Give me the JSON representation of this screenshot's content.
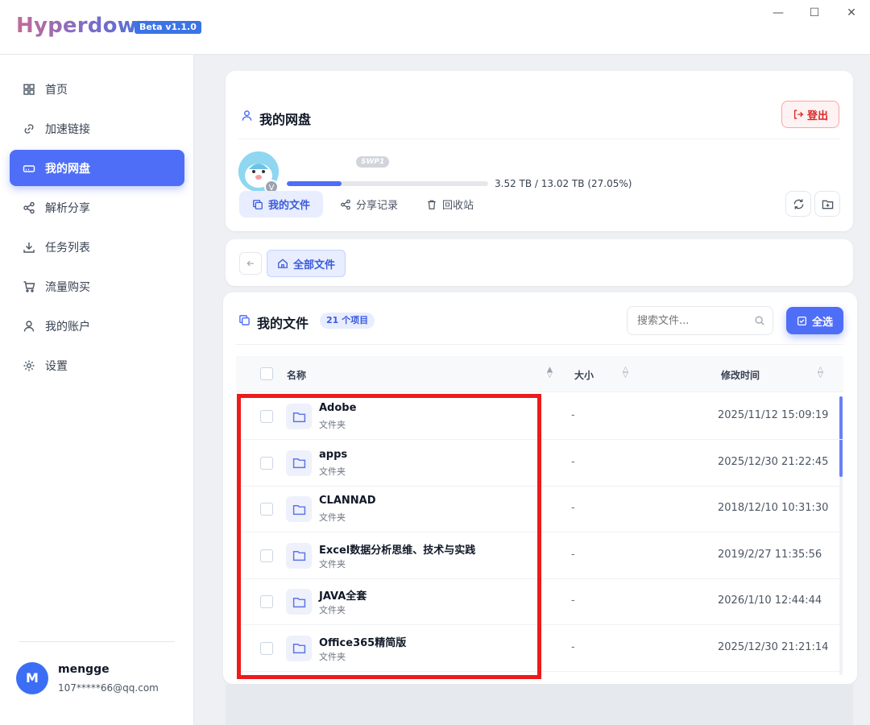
{
  "app": {
    "title": "Hyperdown",
    "version": "Beta v1.1.0",
    "window_controls": {
      "minimize": "—",
      "maximize": "☐",
      "close": "✕"
    }
  },
  "sidebar": {
    "items": [
      {
        "label": "首页",
        "icon": "grid-icon"
      },
      {
        "label": "加速链接",
        "icon": "link-icon"
      },
      {
        "label": "我的网盘",
        "icon": "drive-icon",
        "active": true
      },
      {
        "label": "解析分享",
        "icon": "share-icon"
      },
      {
        "label": "任务列表",
        "icon": "download-icon"
      },
      {
        "label": "流量购买",
        "icon": "cart-icon"
      },
      {
        "label": "我的账户",
        "icon": "user-icon"
      },
      {
        "label": "设置",
        "icon": "gear-icon"
      }
    ],
    "user": {
      "initial": "M",
      "name": "mengge",
      "email": "107*****66@qq.com"
    }
  },
  "account_card": {
    "title": "我的网盘",
    "logout_label": "登出",
    "tier_badge": "SWP1",
    "avatar_badge": "V",
    "quota_text": "3.52 TB / 13.02 TB (27.05%)",
    "quota_fraction": 0.2705,
    "tabs": [
      {
        "label": "我的文件",
        "icon": "copy-icon",
        "active": true
      },
      {
        "label": "分享记录",
        "icon": "share-icon"
      },
      {
        "label": "回收站",
        "icon": "trash-icon"
      }
    ]
  },
  "breadcrumb": {
    "root_label": "全部文件"
  },
  "files": {
    "title": "我的文件",
    "count_badge": "21 个项目",
    "search_placeholder": "搜索文件...",
    "select_all_label": "全选",
    "columns": {
      "name": "名称",
      "size": "大小",
      "modified": "修改时间"
    },
    "rows": [
      {
        "name": "Adobe",
        "type": "文件夹",
        "size": "-",
        "modified": "2025/11/12 15:09:19"
      },
      {
        "name": "apps",
        "type": "文件夹",
        "size": "-",
        "modified": "2025/12/30 21:22:45"
      },
      {
        "name": "CLANNAD",
        "type": "文件夹",
        "size": "-",
        "modified": "2018/12/10 10:31:30"
      },
      {
        "name": "Excel数据分析思维、技术与实践",
        "type": "文件夹",
        "size": "-",
        "modified": "2019/2/27 11:35:56"
      },
      {
        "name": "JAVA全套",
        "type": "文件夹",
        "size": "-",
        "modified": "2026/1/10 12:44:44"
      },
      {
        "name": "Office365精简版",
        "type": "文件夹",
        "size": "-",
        "modified": "2025/12/30 21:21:14"
      }
    ]
  },
  "colors": {
    "accent": "#4f6ef7",
    "danger": "#dc2626",
    "highlight": "#ef1a1a"
  }
}
